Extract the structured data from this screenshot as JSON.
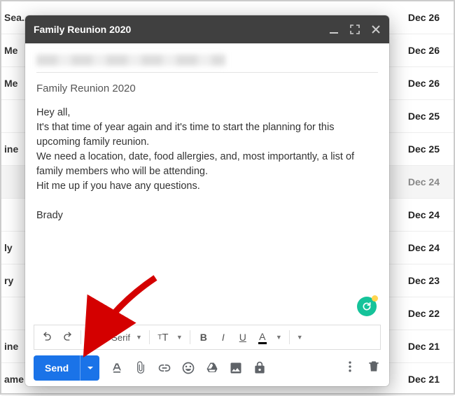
{
  "inbox": {
    "rows": [
      {
        "sender": "Sea...",
        "date": "Dec 26"
      },
      {
        "sender": "Me",
        "date": "Dec 26"
      },
      {
        "sender": "Me",
        "date": "Dec 26"
      },
      {
        "sender": "",
        "date": "Dec 25"
      },
      {
        "sender": "ine",
        "date": "Dec 25"
      },
      {
        "sender": "",
        "date": "Dec 24",
        "selected": true
      },
      {
        "sender": "",
        "date": "Dec 24"
      },
      {
        "sender": "ly",
        "date": "Dec 24"
      },
      {
        "sender": "ry",
        "date": "Dec 23"
      },
      {
        "sender": "",
        "date": "Dec 22"
      },
      {
        "sender": "ine",
        "date": "Dec 21"
      },
      {
        "sender": "ame",
        "date": "Dec 21"
      }
    ]
  },
  "compose": {
    "title": "Family Reunion 2020",
    "subject": "Family Reunion 2020",
    "body": "Hey all,\nIt's that time of year again and it's time to start the planning for this upcoming family reunion.\nWe need a location, date, food allergies, and, most importantly, a list of family members who will be attending.\nHit me up if you have any questions.\n\nBrady",
    "font_name": "Sans Serif",
    "send_label": "Send"
  }
}
